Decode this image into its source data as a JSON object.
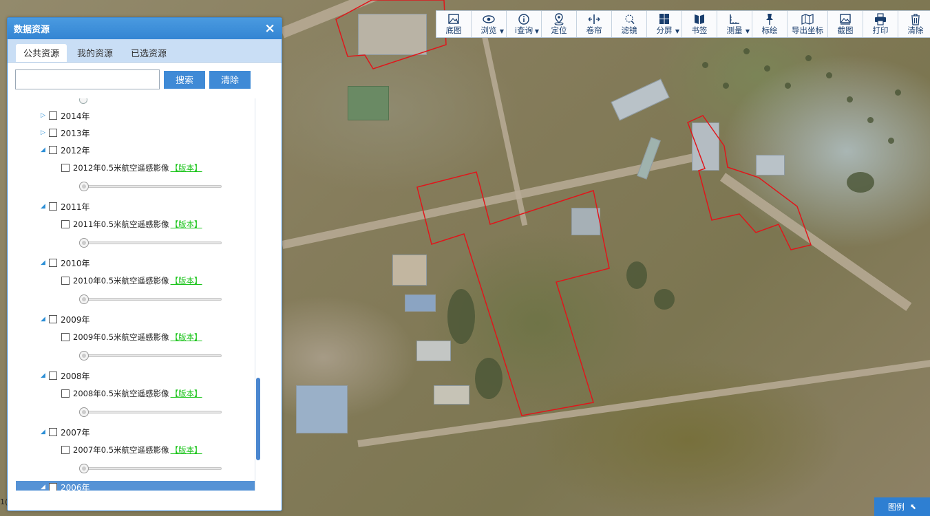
{
  "toolbar": {
    "items": [
      {
        "label": "底图",
        "icon": "basemap-icon",
        "dropdown": false
      },
      {
        "label": "浏览",
        "icon": "eye-icon",
        "dropdown": true
      },
      {
        "label": "i查询",
        "icon": "info-icon",
        "dropdown": true
      },
      {
        "label": "定位",
        "icon": "locate-icon",
        "dropdown": false
      },
      {
        "label": "卷帘",
        "icon": "swipe-icon",
        "dropdown": false
      },
      {
        "label": "滤镜",
        "icon": "filter-icon",
        "dropdown": false
      },
      {
        "label": "分屏",
        "icon": "split-screen-icon",
        "dropdown": true
      },
      {
        "label": "书签",
        "icon": "bookmark-icon",
        "dropdown": false
      },
      {
        "label": "测量",
        "icon": "measure-icon",
        "dropdown": true
      },
      {
        "label": "标绘",
        "icon": "pin-icon",
        "dropdown": false
      },
      {
        "label": "导出坐标",
        "icon": "export-coords-icon",
        "dropdown": false
      },
      {
        "label": "截图",
        "icon": "screenshot-icon",
        "dropdown": false
      },
      {
        "label": "打印",
        "icon": "print-icon",
        "dropdown": false
      },
      {
        "label": "清除",
        "icon": "trash-icon",
        "dropdown": false
      }
    ]
  },
  "panel": {
    "title": "数据资源",
    "close": "×",
    "tabs": [
      {
        "label": "公共资源",
        "active": true
      },
      {
        "label": "我的资源",
        "active": false
      },
      {
        "label": "已选资源",
        "active": false
      }
    ],
    "search": {
      "value": "",
      "placeholder": ""
    },
    "search_button": "搜索",
    "clear_button": "清除"
  },
  "tree": {
    "collapsed_years": [
      "2014年",
      "2013年"
    ],
    "expanded_years": [
      {
        "year": "2012年",
        "layer": "2012年0.5米航空遥感影像",
        "version": "【版本】",
        "opacity": 0
      },
      {
        "year": "2011年",
        "layer": "2011年0.5米航空遥感影像",
        "version": "【版本】",
        "opacity": 0
      },
      {
        "year": "2010年",
        "layer": "2010年0.5米航空遥感影像",
        "version": "【版本】",
        "opacity": 0
      },
      {
        "year": "2009年",
        "layer": "2009年0.5米航空遥感影像",
        "version": "【版本】",
        "opacity": 0
      },
      {
        "year": "2008年",
        "layer": "2008年0.5米航空遥感影像",
        "version": "【版本】",
        "opacity": 0
      },
      {
        "year": "2007年",
        "layer": "2007年0.5米航空遥感影像",
        "version": "【版本】",
        "opacity": 0
      }
    ],
    "selected_year": "2006年"
  },
  "legend": {
    "label": "图例"
  },
  "coord_hint": "1(",
  "colors": {
    "accent": "#3f8ad6",
    "parcel_outline": "#e0161b",
    "version_link": "#1bc41b"
  }
}
